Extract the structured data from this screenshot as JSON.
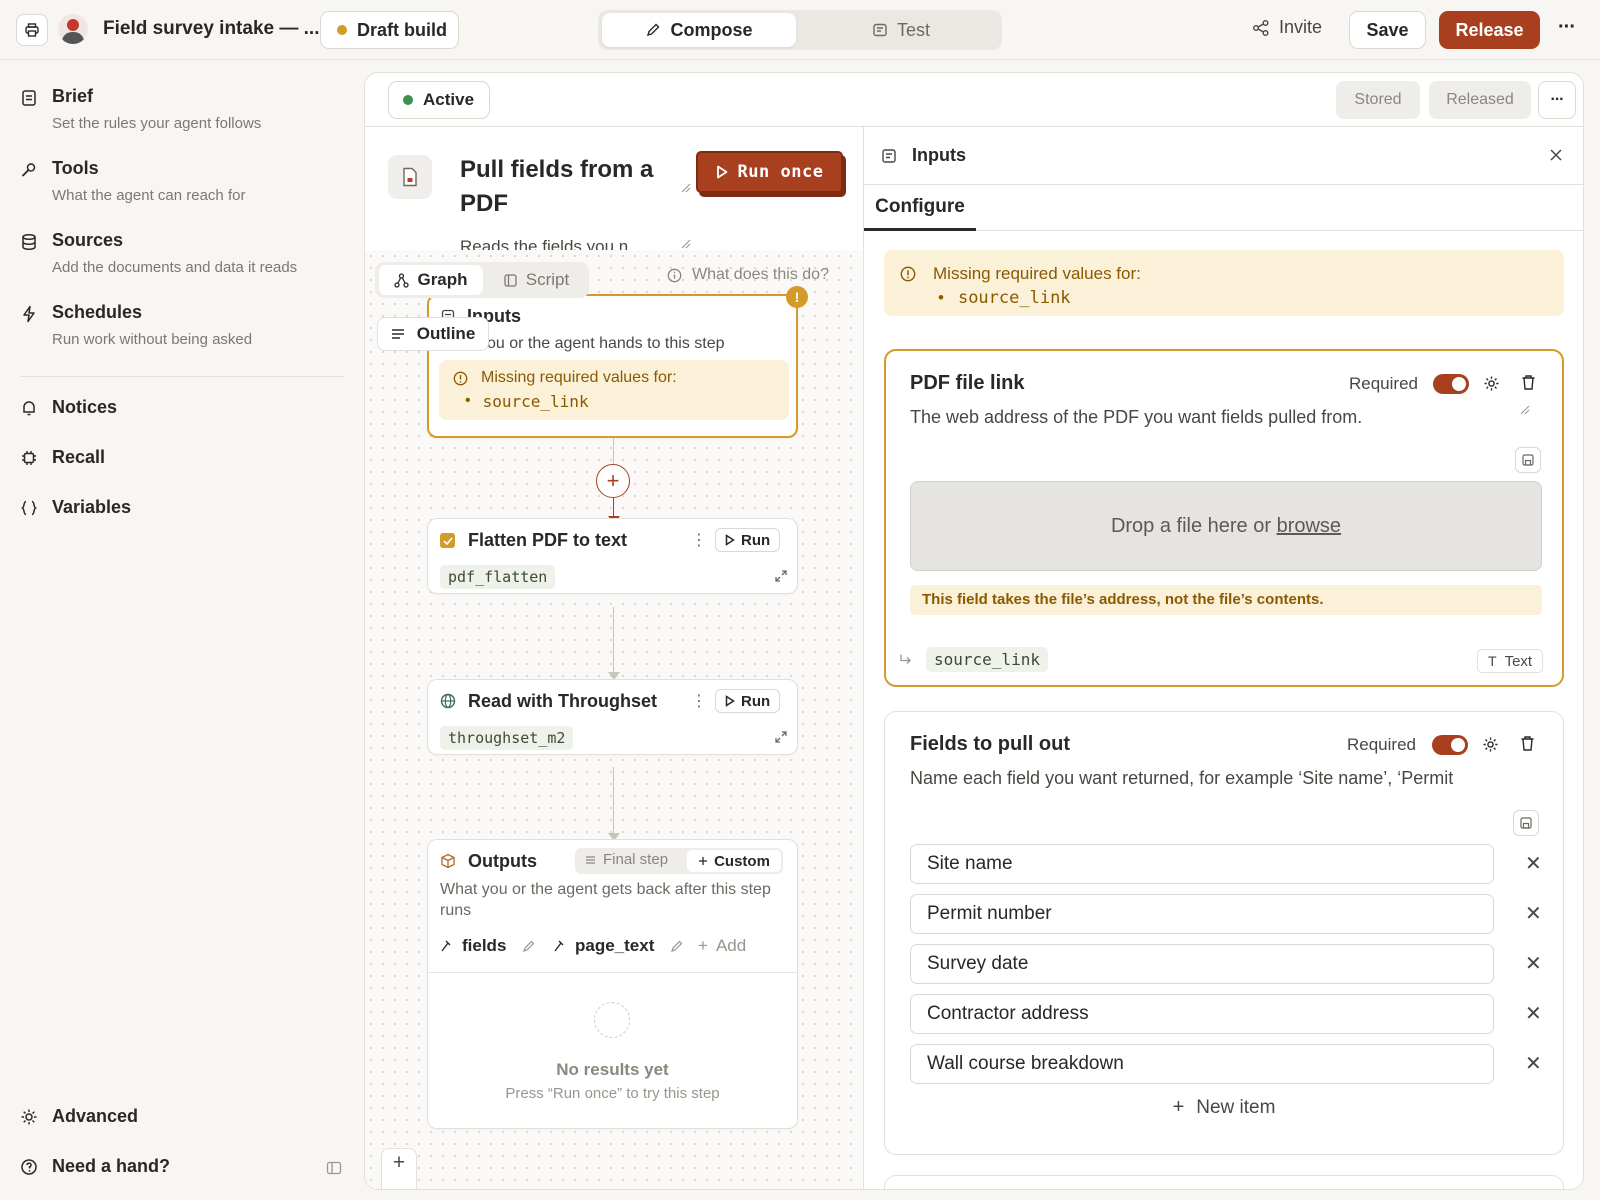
{
  "topbar": {
    "app_title": "Field survey intake — ...",
    "build_status": "Draft build",
    "build_status_color": "#d49a2a",
    "tabs": [
      {
        "label": "Compose",
        "active": true
      },
      {
        "label": "Test",
        "active": false
      }
    ],
    "invite_label": "Invite",
    "save_label": "Save",
    "release_label": "Release",
    "more_label": "···",
    "accent": "#a8401f"
  },
  "sidebar": {
    "primary": [
      {
        "title": "Brief",
        "subtitle": "Set the rules your agent follows",
        "icon": "document-icon"
      },
      {
        "title": "Tools",
        "subtitle": "What the agent can reach for",
        "icon": "wrench-icon"
      },
      {
        "title": "Sources",
        "subtitle": "Add the documents and data it reads",
        "icon": "database-icon"
      },
      {
        "title": "Schedules",
        "subtitle": "Run work without being asked",
        "icon": "lightning-icon"
      }
    ],
    "secondary": [
      {
        "title": "Notices",
        "icon": "bell-icon"
      },
      {
        "title": "Recall",
        "icon": "chip-icon"
      },
      {
        "title": "Variables",
        "icon": "braces-icon"
      }
    ],
    "footer": {
      "advanced": "Advanced",
      "help": "Need a hand?"
    }
  },
  "main": {
    "status": "Active",
    "status_color": "#3f8f4e",
    "stored_label": "Stored",
    "released_label": "Released",
    "step": {
      "title": "Pull fields from a PDF",
      "description": "Reads the fields you n",
      "run_once_label": "Run once"
    },
    "view_tabs": [
      "Graph",
      "Script"
    ],
    "outline_label": "Outline",
    "help_text": "What does this do?",
    "nodes": {
      "inputs": {
        "title": "Inputs",
        "subtitle": "ou or the agent hands to this step",
        "warning": "Missing required values for:",
        "missing": "source_link"
      },
      "flatten": {
        "title": "Flatten PDF to text",
        "chip": "pdf_flatten",
        "run_label": "Run"
      },
      "read": {
        "title": "Read with Throughset",
        "chip": "throughset_m2",
        "run_label": "Run"
      },
      "outputs": {
        "title": "Outputs",
        "final_step_label": "Final step",
        "custom_label": "Custom",
        "subtitle": "What you or the agent gets back after this step runs",
        "fields": [
          "fields",
          "page_text"
        ],
        "add_label": "Add",
        "empty_title": "No results yet",
        "empty_hint": "Press “Run once” to try this step"
      }
    },
    "zoom_controls": {
      "in": "+",
      "out": "−"
    }
  },
  "inputs_panel": {
    "title": "Inputs",
    "tab": "Configure",
    "warning": "Missing required values for:",
    "missing": "source_link",
    "pdf_card": {
      "title": "PDF file link",
      "required_label": "Required",
      "description": "The web address of the PDF you want fields pulled from.",
      "drop_text": "Drop a file here or ",
      "browse_label": "browse",
      "notice": "This field takes the file’s address, not the file’s contents.",
      "variable": "source_link",
      "type_label": "Text"
    },
    "fields_card": {
      "title": "Fields to pull out",
      "required_label": "Required",
      "description": "Name each field you want returned, for example ‘Site name’, ‘Permit",
      "items": [
        "Site name",
        "Permit number",
        "Survey date",
        "Contractor address",
        "Wall course breakdown"
      ],
      "new_item_label": "New item"
    }
  }
}
